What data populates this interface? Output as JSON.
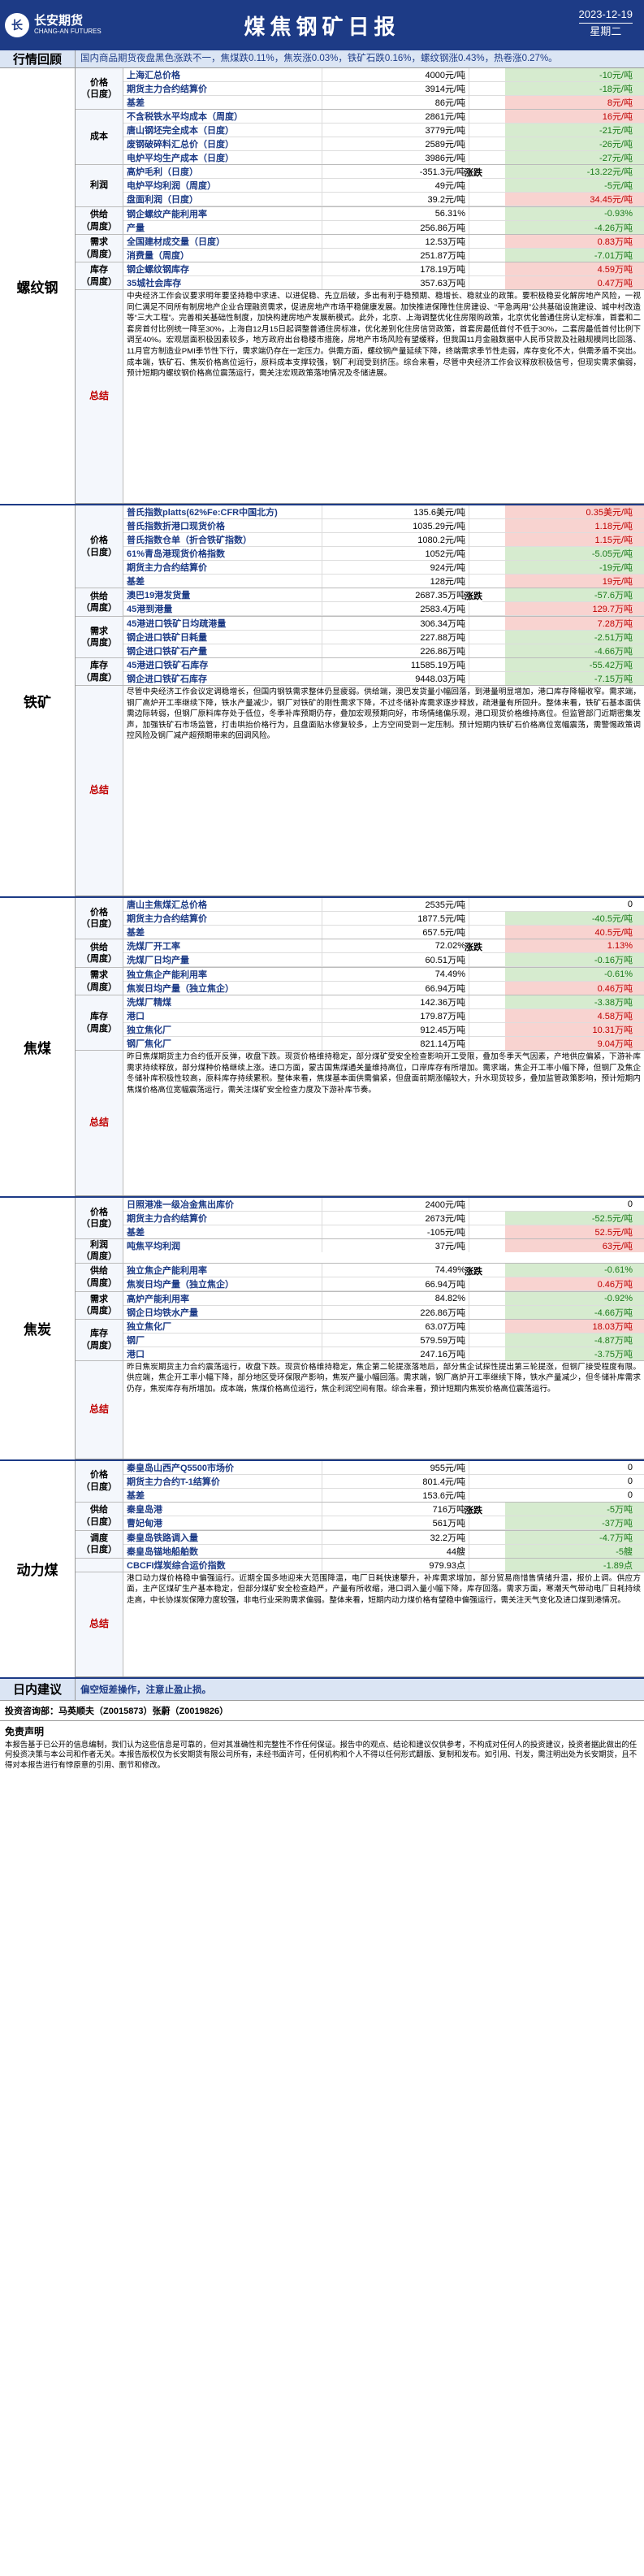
{
  "header": {
    "logo_mark": "长",
    "logo_cn": "长安期货",
    "logo_en": "CHANG-AN FUTURES",
    "title": "煤焦钢矿日报",
    "date": "2023-12-19",
    "weekday": "星期二"
  },
  "market": {
    "label": "行情回顾",
    "text": "国内商品期货夜盘黑色涨跌不一，焦煤跌0.11%，焦炭涨0.03%，铁矿石跌0.16%，螺纹钢涨0.43%，热卷涨0.27%。"
  },
  "sections": [
    {
      "name": "螺纹钢",
      "groups": [
        {
          "label": "价格\n（日度）",
          "rows": [
            {
              "name": "上海汇总价格",
              "value": "4000元/吨",
              "change": "-10元/吨",
              "cls": "dn"
            },
            {
              "name": "期货主力合约结算价",
              "value": "3914元/吨",
              "change": "-18元/吨",
              "cls": "dn"
            },
            {
              "name": "基差",
              "value": "86元/吨",
              "change": "8元/吨",
              "cls": "up"
            }
          ]
        },
        {
          "label": "成本",
          "rows": [
            {
              "name": "不含税铁水平均成本（周度）",
              "value": "2861元/吨",
              "change": "16元/吨",
              "cls": "up"
            },
            {
              "name": "唐山钢坯完全成本（日度）",
              "value": "3779元/吨",
              "change": "-21元/吨",
              "cls": "dn"
            },
            {
              "name": "废钢破碎料汇总价（日度）",
              "value": "2589元/吨",
              "change": "-26元/吨",
              "cls": "dn"
            },
            {
              "name": "电炉平均生产成本（日度）",
              "value": "3986元/吨",
              "change": "-27元/吨",
              "cls": "dn"
            }
          ]
        },
        {
          "label": "利润",
          "direction": "涨跌",
          "rows": [
            {
              "name": "高炉毛利（日度）",
              "value": "-351.3元/吨",
              "change": "-13.22元/吨",
              "cls": "dn"
            },
            {
              "name": "电炉平均利润（周度）",
              "value": "49元/吨",
              "change": "-5元/吨",
              "cls": "dn"
            },
            {
              "name": "盘面利润（日度）",
              "value": "39.2元/吨",
              "change": "34.45元/吨",
              "cls": "up"
            }
          ]
        },
        {
          "label": "供给\n（周度）",
          "rows": [
            {
              "name": "钢企螺纹产能利用率",
              "value": "56.31%",
              "change": "-0.93%",
              "cls": "dn"
            },
            {
              "name": "产量",
              "value": "256.86万吨",
              "change": "-4.26万吨",
              "cls": "dn"
            }
          ]
        },
        {
          "label": "需求\n（周度）",
          "rows": [
            {
              "name": "全国建材成交量（日度）",
              "value": "12.53万吨",
              "change": "0.83万吨",
              "cls": "up"
            },
            {
              "name": "消费量（周度）",
              "value": "251.87万吨",
              "change": "-7.01万吨",
              "cls": "dn"
            }
          ]
        },
        {
          "label": "库存\n（周度）",
          "rows": [
            {
              "name": "钢企螺纹钢库存",
              "value": "178.19万吨",
              "change": "4.59万吨",
              "cls": "up"
            },
            {
              "name": "35城社会库存",
              "value": "357.63万吨",
              "change": "0.47万吨",
              "cls": "up"
            }
          ]
        }
      ],
      "summary_label": "总结",
      "summary_height": 260,
      "summary": "中央经济工作会议要求明年要坚持稳中求进、以进促稳、先立后破，多出有利于稳预期、稳增长、稳就业的政策。要积极稳妥化解房地产风险，一视同仁满足不同所有制房地产企业合理融资需求，促进房地产市场平稳健康发展。加快推进保障性住房建设、“平急两用”公共基础设施建设、城中村改造等“三大工程”。完善相关基础性制度，加快构建房地产发展新模式。此外，北京、上海调整优化住房限购政策，北京优化普通住房认定标准，首套和二套房首付比例统一降至30%，上海自12月15日起调整普通住房标准，优化差别化住房信贷政策，首套房最低首付不低于30%，二套房最低首付比例下调至40%。宏观层面积极因素较多，地方政府出台稳楼市措施，房地产市场风险有望缓释，但我国11月金融数据中人民币贷款及社融规模同比回落、11月官方制造业PMI季节性下行，需求端仍存在一定压力。供需方面，螺纹钢产量延续下降，终端需求季节性走弱，库存变化不大，供需矛盾不突出。成本端，铁矿石、焦炭价格高位运行，原料成本支撑较强，钢厂利润受到挤压。综合来看，尽管中央经济工作会议释放积极信号，但现实需求偏弱，预计短期内螺纹钢价格高位震荡运行，需关注宏观政策落地情况及冬储进展。",
      "detail_rows": 0
    },
    {
      "name": "铁矿",
      "groups": [
        {
          "label": "价格\n（日度）",
          "rows": [
            {
              "name": "普氏指数platts(62%Fe:CFR中国北方)",
              "value": "135.6美元/吨",
              "change": "0.35美元/吨",
              "cls": "up"
            },
            {
              "name": "普氏指数折港口现货价格",
              "value": "1035.29元/吨",
              "change": "1.18元/吨",
              "cls": "up"
            },
            {
              "name": "普氏指数仓单（折合铁矿指数）",
              "value": "1080.2元/吨",
              "change": "1.15元/吨",
              "cls": "up"
            },
            {
              "name": "61%青岛港现货价格指数",
              "value": "1052元/吨",
              "change": "-5.05元/吨",
              "cls": "dn"
            },
            {
              "name": "期货主力合约结算价",
              "value": "924元/吨",
              "change": "-19元/吨",
              "cls": "dn"
            },
            {
              "name": "基差",
              "value": "128元/吨",
              "change": "19元/吨",
              "cls": "up"
            }
          ]
        },
        {
          "label": "供给\n（周度）",
          "direction": "涨跌",
          "rows": [
            {
              "name": "澳巴19港发货量",
              "value": "2687.35万吨",
              "change": "-57.6万吨",
              "cls": "dn"
            },
            {
              "name": "45港到港量",
              "value": "2583.4万吨",
              "change": "129.7万吨",
              "cls": "up"
            }
          ]
        },
        {
          "label": "需求\n（周度）",
          "rows": [
            {
              "name": "45港进口铁矿日均疏港量",
              "value": "306.34万吨",
              "change": "7.28万吨",
              "cls": "up"
            },
            {
              "name": "钢企进口铁矿日耗量",
              "value": "227.88万吨",
              "change": "-2.51万吨",
              "cls": "dn"
            },
            {
              "name": "钢企进口铁矿石产量",
              "value": "226.86万吨",
              "change": "-4.66万吨",
              "cls": "dn"
            }
          ]
        },
        {
          "label": "库存\n（周度）",
          "rows": [
            {
              "name": "45港进口铁矿石库存",
              "value": "11585.19万吨",
              "change": "-55.42万吨",
              "cls": "dn"
            },
            {
              "name": "钢企进口铁矿石库存",
              "value": "9448.03万吨",
              "change": "-7.15万吨",
              "cls": "dn"
            }
          ]
        }
      ],
      "summary_label": "总结",
      "summary_height": 256,
      "summary": "尽管中央经济工作会议定调稳增长，但国内钢铁需求整体仍显疲弱。供给端，澳巴发货量小幅回落，到港量明显增加，港口库存降幅收窄。需求端，钢厂高炉开工率继续下降，铁水产量减少，钢厂对铁矿的刚性需求下降，不过冬储补库需求逐步释放，疏港量有所回升。整体来看，铁矿石基本面供需边际转弱，但钢厂原料库存处于低位，冬季补库预期仍存，叠加宏观预期向好，市场情绪偏乐观，港口现货价格维持高位。但监管部门近期密集发声，加强铁矿石市场监管，打击哄抬价格行为，且盘面贴水修复较多，上方空间受到一定压制。预计短期内铁矿石价格高位宽幅震荡，需警惕政策调控风险及钢厂减产超预期带来的回调风险。",
      "detail_rows": 0
    },
    {
      "name": "焦煤",
      "groups": [
        {
          "label": "价格\n（日度）",
          "rows": [
            {
              "name": "唐山主焦煤汇总价格",
              "value": "2535元/吨",
              "change": "0",
              "cls": "flat"
            },
            {
              "name": "期货主力合约结算价",
              "value": "1877.5元/吨",
              "change": "-40.5元/吨",
              "cls": "dn"
            },
            {
              "name": "基差",
              "value": "657.5元/吨",
              "change": "40.5元/吨",
              "cls": "up"
            }
          ]
        },
        {
          "label": "供给\n（周度）",
          "direction": "涨跌",
          "rows": [
            {
              "name": "洗煤厂开工率",
              "value": "72.02%",
              "change": "1.13%",
              "cls": "up"
            },
            {
              "name": "洗煤厂日均产量",
              "value": "60.51万吨",
              "change": "-0.16万吨",
              "cls": "dn"
            }
          ]
        },
        {
          "label": "需求\n（周度）",
          "rows": [
            {
              "name": "独立焦企产能利用率",
              "value": "74.49%",
              "change": "-0.61%",
              "cls": "dn"
            },
            {
              "name": "焦炭日均产量（独立焦企）",
              "value": "66.94万吨",
              "change": "0.46万吨",
              "cls": "up"
            }
          ]
        },
        {
          "label": "库存\n（周度）",
          "rows": [
            {
              "name": "洗煤厂精煤",
              "value": "142.36万吨",
              "change": "-3.38万吨",
              "cls": "dn"
            },
            {
              "name": "港口",
              "value": "179.87万吨",
              "change": "4.58万吨",
              "cls": "up"
            },
            {
              "name": "独立焦化厂",
              "value": "912.45万吨",
              "change": "10.31万吨",
              "cls": "up"
            },
            {
              "name": "钢厂焦化厂",
              "value": "821.14万吨",
              "change": "9.04万吨",
              "cls": "up"
            }
          ]
        }
      ],
      "summary_label": "总结",
      "summary_height": 176,
      "summary": "昨日焦煤期货主力合约低开反弹，收盘下跌。现货价格维持稳定，部分煤矿受安全检查影响开工受限，叠加冬季天气因素，产地供应偏紧，下游补库需求持续释放，部分煤种价格继续上涨。进口方面，蒙古国焦煤通关量维持高位，口岸库存有所增加。需求端，焦企开工率小幅下降，但钢厂及焦企冬储补库积极性较高，原料库存持续累积。整体来看，焦煤基本面供需偏紧，但盘面前期涨幅较大，升水现货较多，叠加监管政策影响，预计短期内焦煤价格高位宽幅震荡运行，需关注煤矿安全检查力度及下游补库节奏。",
      "detail_rows": 0
    },
    {
      "name": "焦炭",
      "groups": [
        {
          "label": "价格\n（日度）",
          "rows": [
            {
              "name": "日照港准一级冶金焦出库价",
              "value": "2400元/吨",
              "change": "0",
              "cls": "flat"
            },
            {
              "name": "期货主力合约结算价",
              "value": "2673元/吨",
              "change": "-52.5元/吨",
              "cls": "dn"
            },
            {
              "name": "基差",
              "value": "-105元/吨",
              "change": "52.5元/吨",
              "cls": "up"
            }
          ]
        },
        {
          "label": "利润\n（周度）",
          "rows": [
            {
              "name": "吨焦平均利润",
              "value": "37元/吨",
              "change": "63元/吨",
              "cls": "up"
            }
          ]
        },
        {
          "label": "供给\n（周度）",
          "direction": "涨跌",
          "rows": [
            {
              "name": "独立焦企产能利用率",
              "value": "74.49%",
              "change": "-0.61%",
              "cls": "dn"
            },
            {
              "name": "焦炭日均产量（独立焦企）",
              "value": "66.94万吨",
              "change": "0.46万吨",
              "cls": "up"
            }
          ]
        },
        {
          "label": "需求\n（周度）",
          "rows": [
            {
              "name": "高炉产能利用率",
              "value": "84.82%",
              "change": "-0.92%",
              "cls": "dn"
            },
            {
              "name": "钢企日均铁水产量",
              "value": "226.86万吨",
              "change": "-4.66万吨",
              "cls": "dn"
            }
          ]
        },
        {
          "label": "库存\n（周度）",
          "rows": [
            {
              "name": "独立焦化厂",
              "value": "63.07万吨",
              "change": "18.03万吨",
              "cls": "up"
            },
            {
              "name": "钢厂",
              "value": "579.59万吨",
              "change": "-4.87万吨",
              "cls": "dn"
            },
            {
              "name": "港口",
              "value": "247.16万吨",
              "change": "-3.75万吨",
              "cls": "dn"
            }
          ]
        }
      ],
      "summary_label": "总结",
      "summary_height": 118,
      "summary": "昨日焦炭期货主力合约震荡运行，收盘下跌。现货价格维持稳定，焦企第二轮提涨落地后，部分焦企试探性提出第三轮提涨，但钢厂接受程度有限。供应端，焦企开工率小幅下降，部分地区受环保限产影响，焦炭产量小幅回落。需求端，钢厂高炉开工率继续下降，铁水产量减少，但冬储补库需求仍存，焦炭库存有所增加。成本端，焦煤价格高位运行，焦企利润空间有限。综合来看，预计短期内焦炭价格高位震荡运行。",
      "detail_rows": 0
    },
    {
      "name": "动力煤",
      "groups": [
        {
          "label": "价格\n（日度）",
          "rows": [
            {
              "name": "秦皇岛山西产Q5500市场价",
              "value": "955元/吨",
              "change": "0",
              "cls": "flat"
            },
            {
              "name": "期货主力合约T-1结算价",
              "value": "801.4元/吨",
              "change": "0",
              "cls": "flat"
            },
            {
              "name": "基差",
              "value": "153.6元/吨",
              "change": "0",
              "cls": "flat"
            }
          ]
        },
        {
          "label": "供给\n（日度）",
          "direction": "涨跌",
          "rows": [
            {
              "name": "秦皇岛港",
              "value": "716万吨",
              "change": "-5万吨",
              "cls": "dn"
            },
            {
              "name": "曹妃甸港",
              "value": "561万吨",
              "change": "-37万吨",
              "cls": "dn"
            }
          ]
        },
        {
          "label": "调度\n（日度）",
          "rows": [
            {
              "name": "秦皇岛铁路调入量",
              "value": "32.2万吨",
              "change": "-4.7万吨",
              "cls": "dn"
            },
            {
              "name": "秦皇岛锚地船舶数",
              "value": "44艘",
              "change": "-5艘",
              "cls": "dn"
            }
          ]
        },
        {
          "label": "",
          "rows": [
            {
              "name": "CBCFI煤炭综合运价指数",
              "value": "979.93点",
              "change": "-1.89点",
              "cls": "dn"
            }
          ]
        }
      ],
      "summary_label": "总结",
      "summary_height": 126,
      "summary": "港口动力煤价格稳中偏强运行。近期全国多地迎来大范围降温，电厂日耗快速攀升，补库需求增加，部分贸易商惜售情绪升温，报价上调。供应方面，主产区煤矿生产基本稳定，但部分煤矿安全检查趋严，产量有所收缩，港口调入量小幅下降，库存回落。需求方面，寒潮天气带动电厂日耗持续走高，中长协煤炭保障力度较强，非电行业采购需求偏弱。整体来看，短期内动力煤价格有望稳中偏强运行，需关注天气变化及进口煤到港情况。",
      "detail_rows": 0
    }
  ],
  "advice": {
    "label": "日内建议",
    "text": "偏空短差操作，注意止盈止损。"
  },
  "invest": "投资咨询部：马英顺夫（Z0015873）张蔚（Z0019826）",
  "disclaimer_title": "免责声明",
  "disclaimer": "本报告基于已公开的信息编制，我们认为这些信息是可靠的，但对其准确性和完整性不作任何保证。报告中的观点、结论和建议仅供参考，不构成对任何人的投资建议，投资者据此做出的任何投资决策与本公司和作者无关。本报告版权仅为长安期货有限公司所有，未经书面许可，任何机构和个人不得以任何形式翻版、复制和发布。如引用、刊发，需注明出处为长安期货，且不得对本报告进行有悖原意的引用、删节和修改。"
}
